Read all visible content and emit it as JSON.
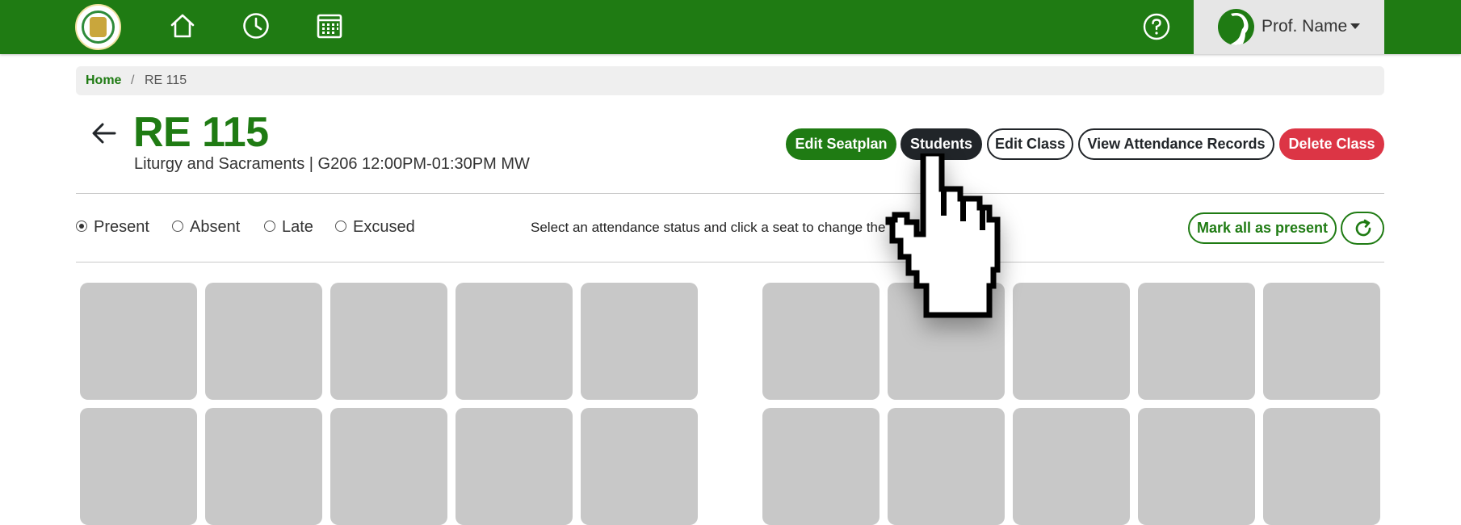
{
  "navbar": {
    "home_icon": "home-icon",
    "clock_icon": "clock-icon",
    "calendar_icon": "calendar-icon",
    "help_icon": "help-icon",
    "profile_name": "Prof. Name",
    "brand_color": "#1f7b13"
  },
  "breadcrumb": {
    "home": "Home",
    "separator": "/",
    "current": "RE 115"
  },
  "course": {
    "code": "RE 115",
    "description": "Liturgy and Sacraments | G206 12:00PM-01:30PM MW"
  },
  "actions": {
    "edit_seatplan": "Edit Seatplan",
    "students": "Students",
    "edit_class": "Edit Class",
    "view_attendance": "View Attendance Records",
    "delete_class": "Delete Class"
  },
  "status": {
    "options": [
      "Present",
      "Absent",
      "Late",
      "Excused"
    ],
    "selected": "Present",
    "instruction": "Select an attendance status and click a seat to change the attendance status.",
    "mark_all": "Mark all as present",
    "refresh_icon": "refresh-icon"
  },
  "colors": {
    "green": "#1f7b13",
    "dark": "#212529",
    "red": "#dc3545",
    "seat": "#c8c8c8"
  }
}
